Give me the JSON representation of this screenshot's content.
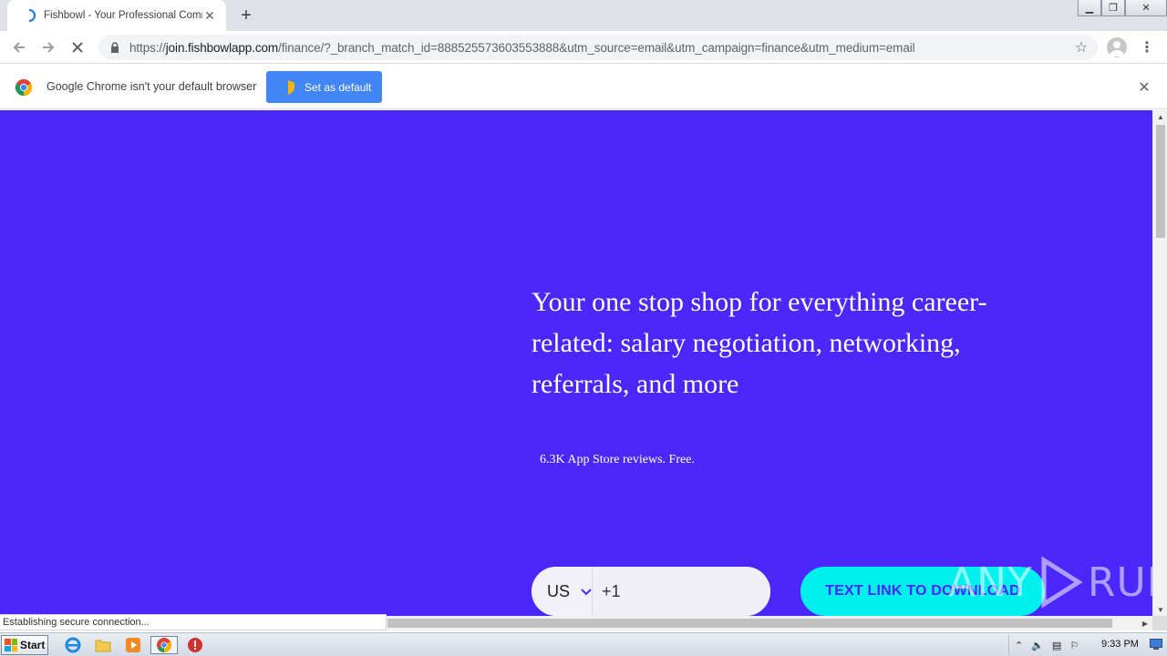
{
  "browser": {
    "tab_title": "Fishbowl - Your Professional Commun",
    "new_tab_symbol": "+",
    "url_scheme": "https://",
    "url_host": "join.fishbowlapp.com",
    "url_path": "/finance/?_branch_match_id=888525573603553888&utm_source=email&utm_campaign=finance&utm_medium=email"
  },
  "infobar": {
    "message": "Google Chrome isn't your default browser",
    "button_label": "Set as default"
  },
  "page": {
    "headline": "Your one stop shop for everything career-related: salary negotiation, networking, referrals, and more",
    "reviews": "6.3K App Store reviews. Free.",
    "country_code": "US",
    "phone_prefix": "+1",
    "cta_label": "TEXT LINK TO DOWNLOAD",
    "background_color": "#4b27fb",
    "cta_color": "#00f0f0"
  },
  "watermark": {
    "left": "ANY",
    "right": "RUN"
  },
  "status": {
    "text": "Establishing secure connection..."
  },
  "taskbar": {
    "start_label": "Start",
    "clock": "9:33 PM"
  }
}
